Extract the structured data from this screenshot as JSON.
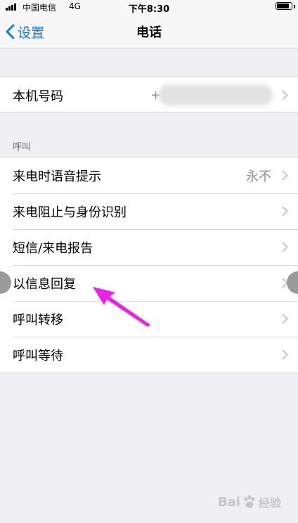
{
  "status_bar": {
    "carrier": "中国电信",
    "network": "4G",
    "time": "下午8:30",
    "battery_level": 0.9
  },
  "nav": {
    "back_label": "设置",
    "title": "电话"
  },
  "group1": {
    "rows": [
      {
        "label": "本机号码",
        "detail_prefix": "+"
      }
    ]
  },
  "call_section": {
    "header": "呼叫",
    "rows": [
      {
        "label": "来电时语音提示",
        "detail": "永不"
      },
      {
        "label": "来电阻止与身份识别"
      },
      {
        "label": "短信/来电报告"
      },
      {
        "label": "以信息回复"
      },
      {
        "label": "呼叫转移"
      },
      {
        "label": "呼叫等待"
      }
    ]
  },
  "annotation": {
    "arrow_color": "#ee1ee8"
  },
  "watermark": {
    "brand": "Bai",
    "product": "经验"
  },
  "colors": {
    "accent": "#0a7aff",
    "background": "#efeff4"
  }
}
